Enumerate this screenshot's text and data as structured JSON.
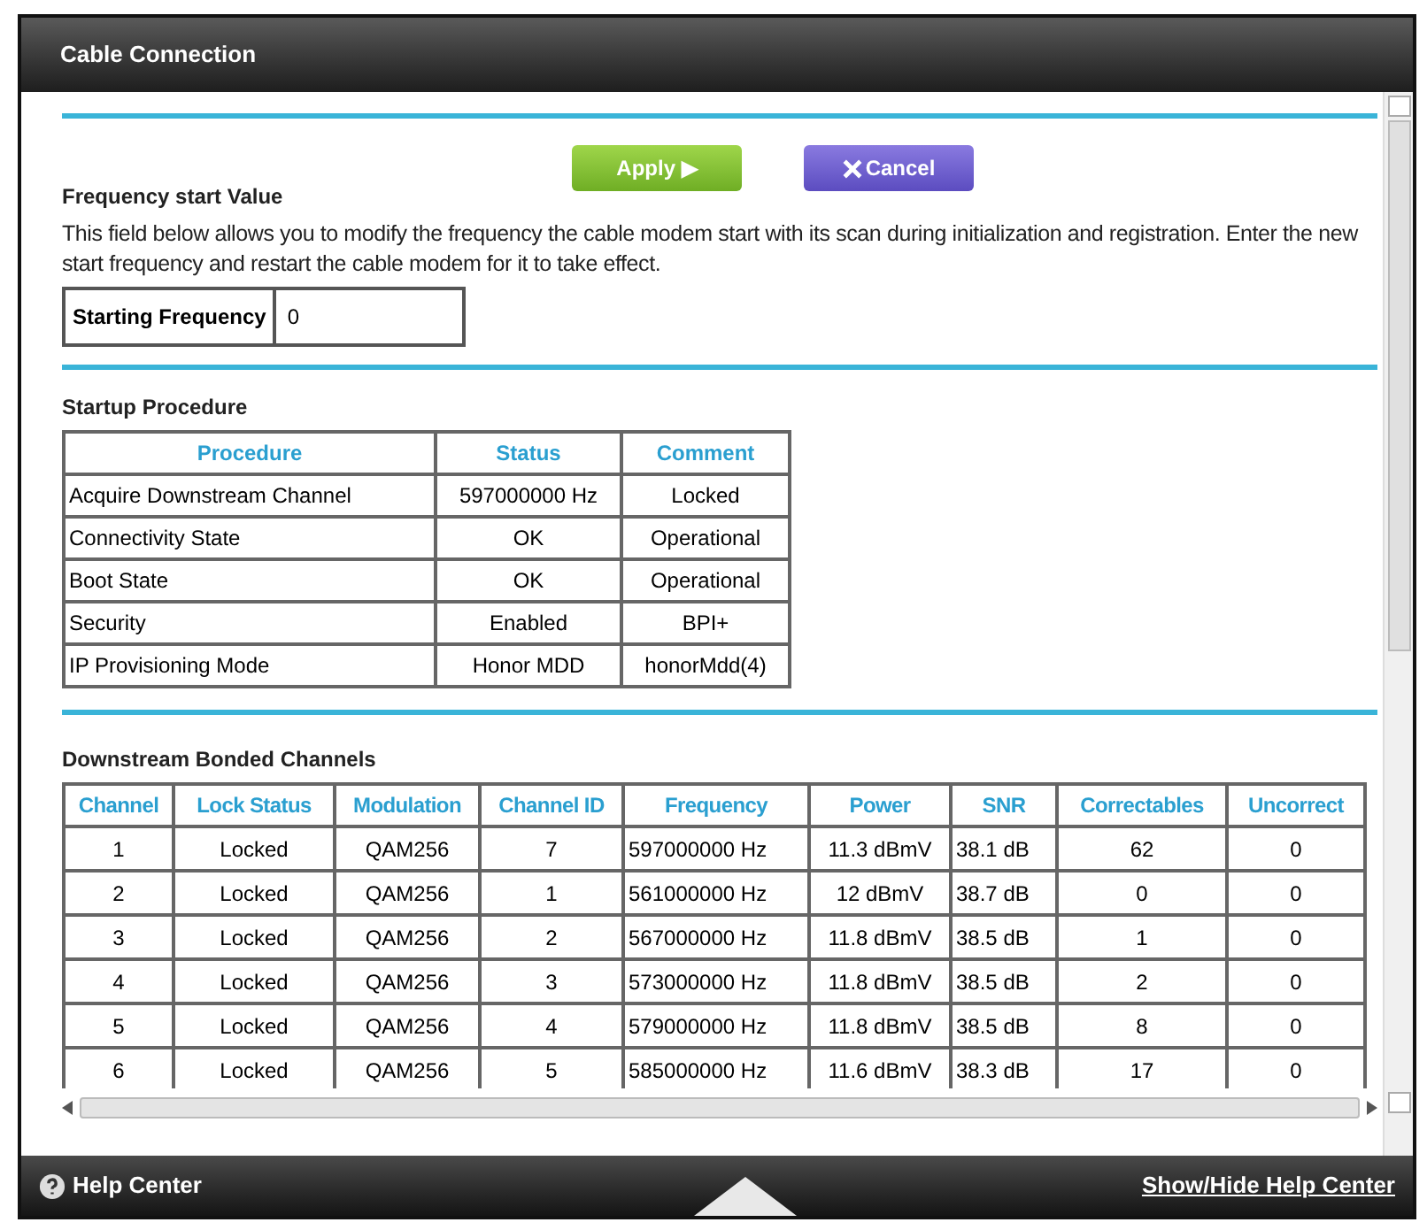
{
  "window": {
    "title": "Cable Connection"
  },
  "buttons": [
    {
      "kind": "apply",
      "label": "Apply ▶"
    },
    {
      "kind": "cancel",
      "label": "Cancel"
    }
  ],
  "frequency": {
    "heading": "Frequency start Value",
    "description": "This field below allows you to modify the frequency the cable modem start with its scan during initialization and registration. Enter the new start frequency and restart the cable modem for it to take effect.",
    "label": "Starting Frequency",
    "value": "0"
  },
  "startup": {
    "heading": "Startup Procedure",
    "columns": [
      "Procedure",
      "Status",
      "Comment"
    ],
    "rows": [
      [
        "Acquire Downstream Channel",
        "597000000 Hz",
        "Locked"
      ],
      [
        "Connectivity State",
        "OK",
        "Operational"
      ],
      [
        "Boot State",
        "OK",
        "Operational"
      ],
      [
        "Security",
        "Enabled",
        "BPI+"
      ],
      [
        "IP Provisioning Mode",
        "Honor MDD",
        "honorMdd(4)"
      ]
    ]
  },
  "downstream": {
    "heading": "Downstream Bonded Channels",
    "columns": [
      "Channel",
      "Lock Status",
      "Modulation",
      "Channel ID",
      "Frequency",
      "Power",
      "SNR",
      "Correctables",
      "Uncorrect"
    ],
    "rows": [
      [
        "1",
        "Locked",
        "QAM256",
        "7",
        "597000000 Hz",
        "11.3 dBmV",
        "38.1 dB",
        "62",
        "0"
      ],
      [
        "2",
        "Locked",
        "QAM256",
        "1",
        "561000000 Hz",
        "12 dBmV",
        "38.7 dB",
        "0",
        "0"
      ],
      [
        "3",
        "Locked",
        "QAM256",
        "2",
        "567000000 Hz",
        "11.8 dBmV",
        "38.5 dB",
        "1",
        "0"
      ],
      [
        "4",
        "Locked",
        "QAM256",
        "3",
        "573000000 Hz",
        "11.8 dBmV",
        "38.5 dB",
        "2",
        "0"
      ],
      [
        "5",
        "Locked",
        "QAM256",
        "4",
        "579000000 Hz",
        "11.8 dBmV",
        "38.5 dB",
        "8",
        "0"
      ],
      [
        "6",
        "Locked",
        "QAM256",
        "5",
        "585000000 Hz",
        "11.6 dBmV",
        "38.3 dB",
        "17",
        "0"
      ]
    ]
  },
  "footer": {
    "help": "Help Center",
    "toggle": "Show/Hide Help Center"
  }
}
